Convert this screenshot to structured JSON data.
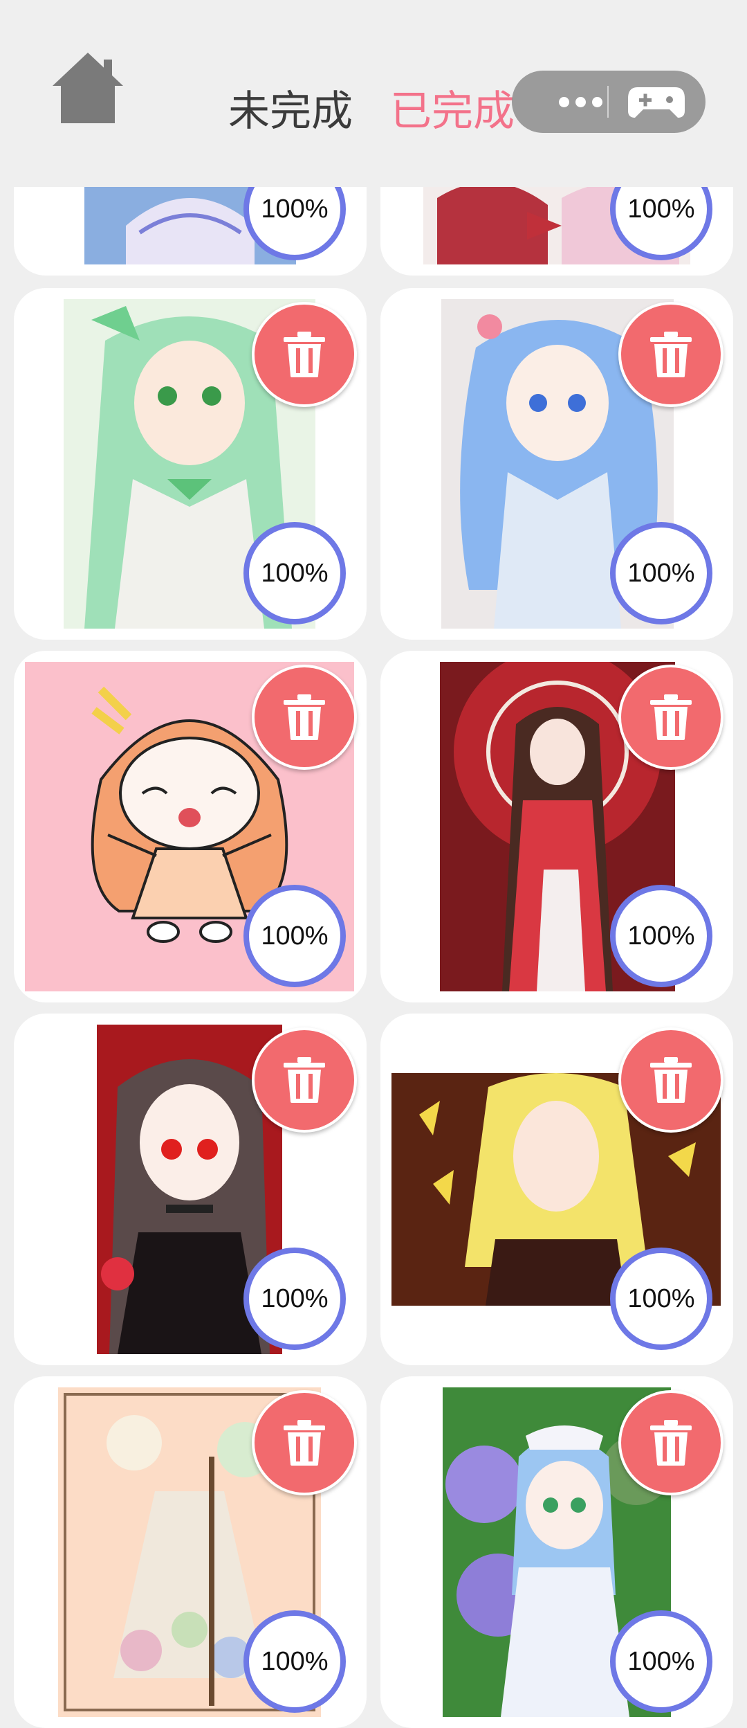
{
  "header": {
    "home_icon": "home-icon",
    "tabs": [
      {
        "label": "未完成",
        "active": false
      },
      {
        "label": "已完成",
        "active": true
      }
    ],
    "capsule_icons": [
      "more-dots-icon",
      "gamepad-icon"
    ]
  },
  "colors": {
    "background": "#efefef",
    "active_tab": "#f3728a",
    "delete_button": "#f26a6e",
    "progress_ring": "#6e78e6"
  },
  "cards": [
    {
      "progress": "100%",
      "artwork": "sky-dress-girl-artwork",
      "has_delete": false
    },
    {
      "progress": "100%",
      "artwork": "red-ribbon-dress-artwork",
      "has_delete": false
    },
    {
      "progress": "100%",
      "artwork": "green-hair-girl-artwork",
      "has_delete": true
    },
    {
      "progress": "100%",
      "artwork": "blue-hair-sailor-girl-artwork",
      "has_delete": true
    },
    {
      "progress": "100%",
      "artwork": "chibi-orange-hair-girl-artwork",
      "has_delete": true
    },
    {
      "progress": "100%",
      "artwork": "red-umbrella-kimono-girl-artwork",
      "has_delete": true
    },
    {
      "progress": "100%",
      "artwork": "red-eyes-dark-hair-girl-artwork",
      "has_delete": true
    },
    {
      "progress": "100%",
      "artwork": "yellow-hair-butterflies-artwork",
      "has_delete": true
    },
    {
      "progress": "100%",
      "artwork": "flower-dress-girl-artwork",
      "has_delete": true
    },
    {
      "progress": "100%",
      "artwork": "hydrangea-maid-girl-artwork",
      "has_delete": true
    }
  ]
}
